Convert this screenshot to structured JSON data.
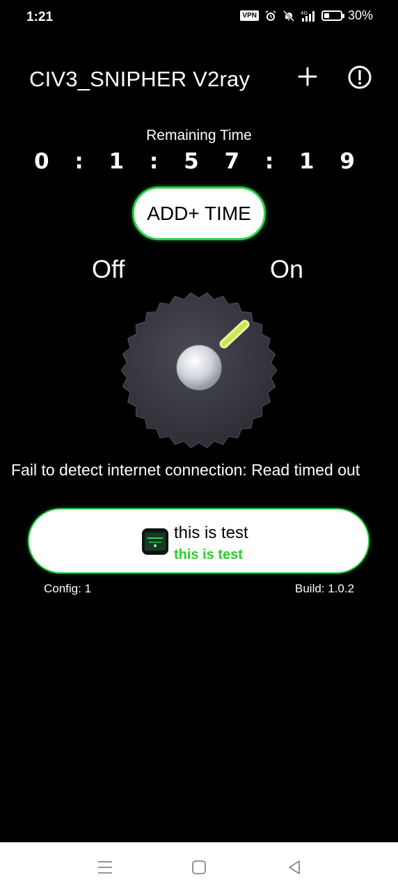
{
  "status_bar": {
    "time": "1:21",
    "vpn": "VPN",
    "battery_percent": "30%",
    "battery_level": 0.3,
    "icons": [
      "alarm-icon",
      "mute-icon",
      "signal-4g-icon",
      "battery-icon"
    ]
  },
  "header": {
    "title": "CIV3_SNIPHER V2ray",
    "add_icon": "plus-icon",
    "info_icon": "info-icon"
  },
  "timer": {
    "label": "Remaining Time",
    "value": "0 : 1 : 5 7 : 1 9"
  },
  "add_time_button": {
    "label": "ADD+ TIME"
  },
  "switch": {
    "off_label": "Off",
    "on_label": "On",
    "state": "on"
  },
  "message": "Fail to detect internet connection: Read timed out",
  "server": {
    "name": "this is test",
    "subtitle": "this is test"
  },
  "footer": {
    "config": "Config: 1",
    "build": "Build: 1.0.2"
  },
  "colors": {
    "accent": "#2ed14a",
    "background": "#000000",
    "knob": "#3a3a42"
  },
  "navbar": {
    "icons": [
      "menu-icon",
      "home-square-icon",
      "back-triangle-icon"
    ]
  }
}
